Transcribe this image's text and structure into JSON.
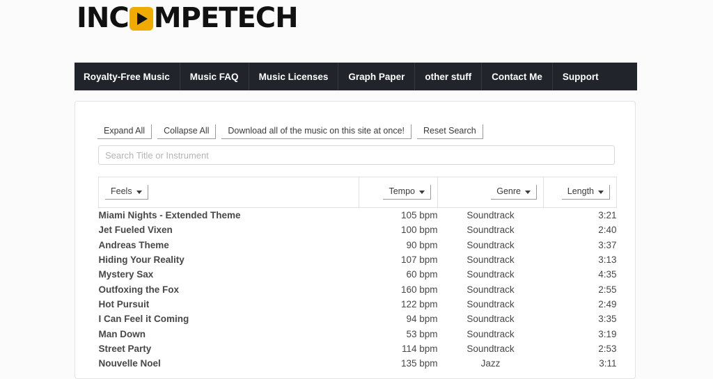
{
  "site": {
    "logo_before": "INC",
    "logo_icon": "play-triangle",
    "logo_after": "MPETECH",
    "logo_accent_color": "#f0ab00"
  },
  "nav": {
    "items": [
      {
        "label": "Royalty-Free Music"
      },
      {
        "label": "Music FAQ"
      },
      {
        "label": "Music Licenses"
      },
      {
        "label": "Graph Paper"
      },
      {
        "label": "other stuff"
      },
      {
        "label": "Contact Me"
      },
      {
        "label": "Support"
      }
    ]
  },
  "toolbar": {
    "expand_all": "Expand All",
    "collapse_all": "Collapse All",
    "download_all": "Download all of the music on this site at once!",
    "reset_search": "Reset Search"
  },
  "search": {
    "value": "",
    "placeholder": "Search Title or Instrument"
  },
  "table": {
    "headers": {
      "feels": "Feels",
      "tempo": "Tempo",
      "genre": "Genre",
      "length": "Length"
    },
    "rows": [
      {
        "title": "Miami Nights - Extended Theme",
        "tempo": "105 bpm",
        "genre": "Soundtrack",
        "length": "3:21"
      },
      {
        "title": "Jet Fueled Vixen",
        "tempo": "100 bpm",
        "genre": "Soundtrack",
        "length": "2:40"
      },
      {
        "title": "Andreas Theme",
        "tempo": "90 bpm",
        "genre": "Soundtrack",
        "length": "3:37"
      },
      {
        "title": "Hiding Your Reality",
        "tempo": "107 bpm",
        "genre": "Soundtrack",
        "length": "3:13"
      },
      {
        "title": "Mystery Sax",
        "tempo": "60 bpm",
        "genre": "Soundtrack",
        "length": "4:35"
      },
      {
        "title": "Outfoxing the Fox",
        "tempo": "160 bpm",
        "genre": "Soundtrack",
        "length": "2:55"
      },
      {
        "title": "Hot Pursuit",
        "tempo": "122 bpm",
        "genre": "Soundtrack",
        "length": "2:49"
      },
      {
        "title": "I Can Feel it Coming",
        "tempo": "94 bpm",
        "genre": "Soundtrack",
        "length": "3:35"
      },
      {
        "title": "Man Down",
        "tempo": "53 bpm",
        "genre": "Soundtrack",
        "length": "3:19"
      },
      {
        "title": "Street Party",
        "tempo": "114 bpm",
        "genre": "Soundtrack",
        "length": "2:53"
      },
      {
        "title": "Nouvelle Noel",
        "tempo": "135 bpm",
        "genre": "Jazz",
        "length": "3:11"
      }
    ]
  }
}
